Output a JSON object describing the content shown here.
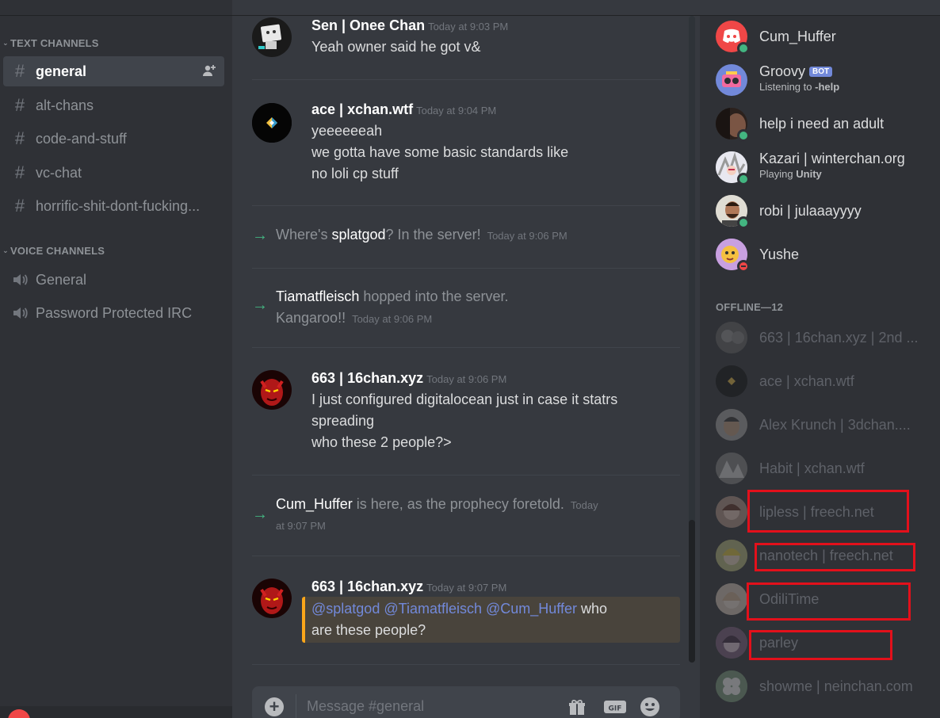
{
  "sidebar": {
    "text_category": "TEXT CHANNELS",
    "voice_category": "VOICE CHANNELS",
    "text_channels": [
      {
        "label": "general",
        "active": true
      },
      {
        "label": "alt-chans"
      },
      {
        "label": "code-and-stuff"
      },
      {
        "label": "vc-chat"
      },
      {
        "label": "horrific-shit-dont-fucking..."
      }
    ],
    "voice_channels": [
      {
        "label": "General"
      },
      {
        "label": "Password Protected IRC"
      }
    ]
  },
  "chat": {
    "messages": [
      {
        "author": "Sen | Onee Chan",
        "time": "Today at 9:03 PM",
        "lines": [
          "Yeah owner said he got v&"
        ]
      },
      {
        "author": "ace | xchan.wtf",
        "time": "Today at 9:04 PM",
        "lines": [
          "yeeeeeeah",
          "we gotta have some basic standards like",
          "no loli cp stuff"
        ]
      },
      {
        "author": "663 | 16chan.xyz",
        "time": "Today at 9:06 PM",
        "lines": [
          "I just configured digitalocean just in case it statrs",
          "spreading",
          "who these 2 people?>"
        ]
      },
      {
        "author": "663 | 16chan.xyz",
        "time": "Today at 9:07 PM",
        "mentions": [
          "@splatgod",
          "@Tiamatfleisch",
          "@Cum_Huffer"
        ],
        "after_mentions": "who",
        "lines": [
          "are these people?"
        ]
      }
    ],
    "system": [
      {
        "pre": "Where's ",
        "name": "splatgod",
        "post": "? In the server!",
        "time": "Today at 9:06 PM"
      },
      {
        "name": "Tiamatfleisch",
        "post": " hopped into the server.",
        "line2": "Kangaroo!!",
        "time": "Today at 9:06 PM"
      },
      {
        "name": "Cum_Huffer",
        "post": " is here, as the prophecy foretold.",
        "time_a": "Today",
        "time_b": "at 9:07 PM"
      }
    ],
    "composer_placeholder": "Message #general"
  },
  "members": {
    "online": [
      {
        "name": "Cum_Huffer",
        "status": "online"
      },
      {
        "name": "Groovy",
        "bot": "BOT",
        "sub_pre": "Listening to",
        "sub_bold": "-help"
      },
      {
        "name": "help i need an adult",
        "status": "online"
      },
      {
        "name": "Kazari | winterchan.org",
        "status": "online",
        "sub_pre": "Playing",
        "sub_bold": "Unity"
      },
      {
        "name": "robi | julaaayyyy",
        "status": "online"
      },
      {
        "name": "Yushe",
        "status": "dnd"
      }
    ],
    "offline_header": "OFFLINE—12",
    "offline": [
      {
        "name": "663 | 16chan.xyz | 2nd ..."
      },
      {
        "name": "ace | xchan.wtf"
      },
      {
        "name": "Alex Krunch | 3dchan...."
      },
      {
        "name": "Habit | xchan.wtf"
      },
      {
        "name": "lipless | freech.net"
      },
      {
        "name": "nanotech | freech.net"
      },
      {
        "name": "OdiliTime"
      },
      {
        "name": "parley"
      },
      {
        "name": "showme | neinchan.com"
      }
    ]
  },
  "colors": {
    "accent": "#7289da",
    "online": "#43b581",
    "dnd": "#f04747",
    "highlight_box": "#e3101b",
    "mention_bar": "#faa61a"
  }
}
